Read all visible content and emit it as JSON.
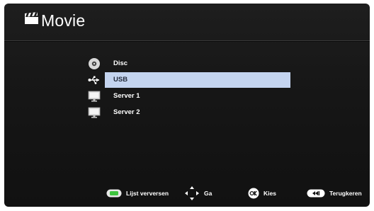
{
  "header": {
    "title": "Movie",
    "icon": "clapperboard-icon"
  },
  "menu": {
    "selected_index": 1,
    "items": [
      {
        "label": "Disc",
        "icon": "disc-icon"
      },
      {
        "label": "USB",
        "icon": "usb-icon"
      },
      {
        "label": "Server 1",
        "icon": "server-icon"
      },
      {
        "label": "Server 2",
        "icon": "server-icon"
      }
    ]
  },
  "footer": {
    "refresh": {
      "label": "Lijst verversen",
      "icon": "green-button-icon"
    },
    "navigate": {
      "label": "Ga",
      "icon": "arrow-pad-icon"
    },
    "select": {
      "label": "Kies",
      "icon": "ok-button-icon"
    },
    "back": {
      "label": "Terugkeren",
      "icon": "back-button-icon"
    }
  },
  "colors": {
    "background": "#161616",
    "highlight": "#c4d4ef",
    "refresh_button": "#3ec43e"
  }
}
